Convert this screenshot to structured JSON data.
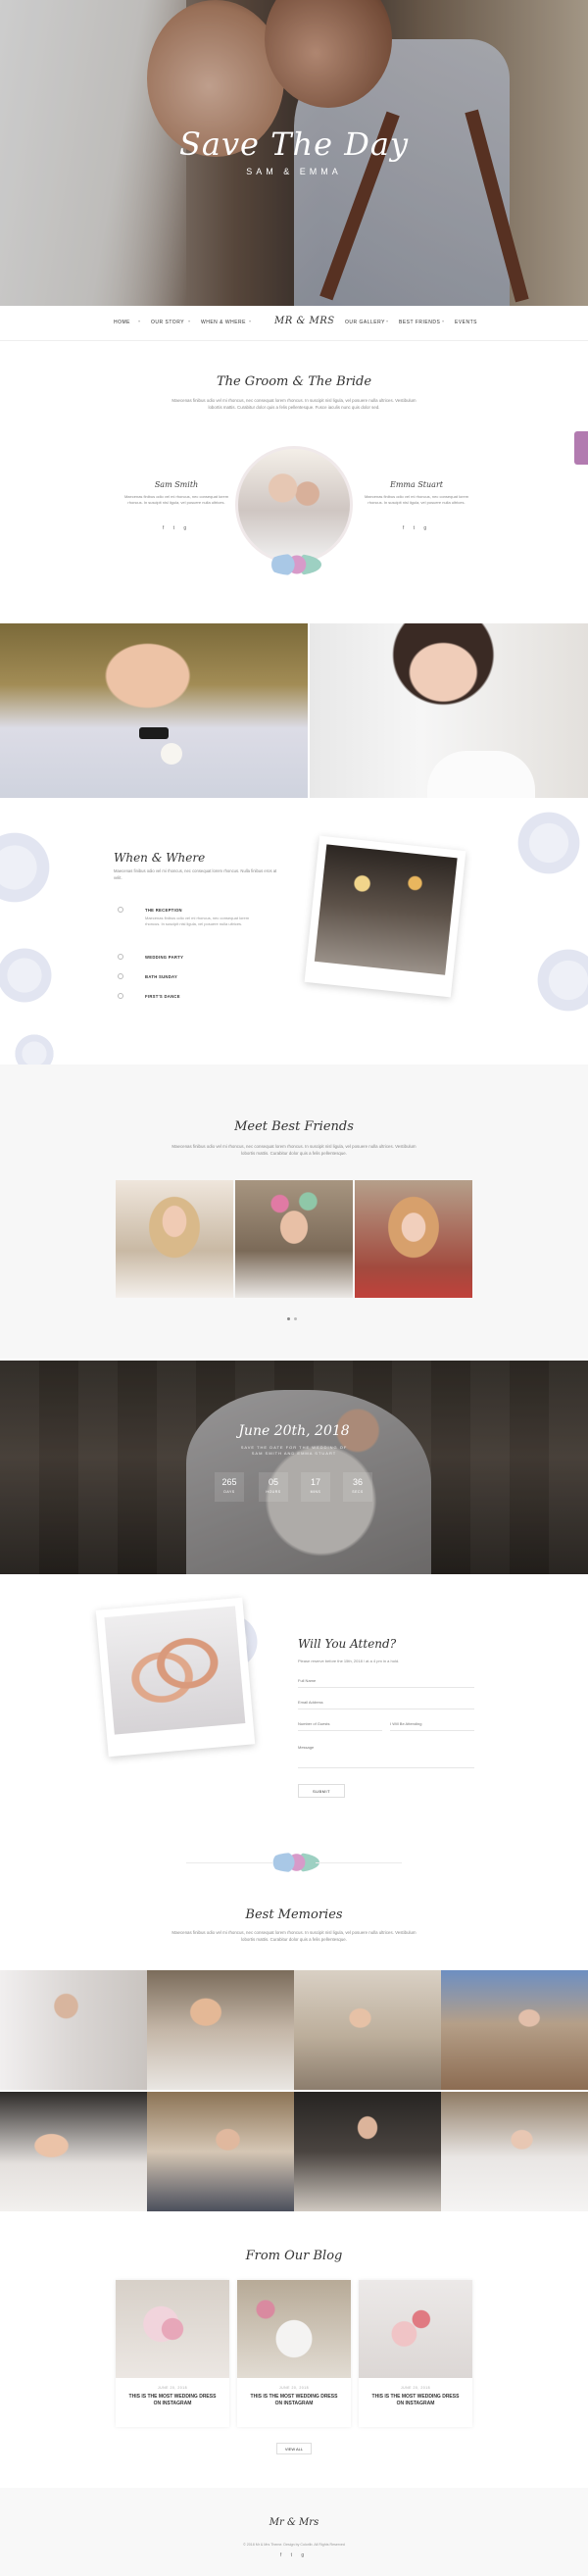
{
  "hero": {
    "title": "Save The Day",
    "subtitle": "SAM & EMMA"
  },
  "nav": {
    "items": [
      "HOME",
      "OUR STORY",
      "WHEN & WHERE",
      "OUR GALLERY",
      "BEST FRIENDS",
      "EVENTS"
    ],
    "logo": "Mr & Mrs"
  },
  "couple": {
    "title": "The Groom & The Bride",
    "desc": "Maecenas finibus odio vel mi rhoncus, nec consequat lorem rhoncus. In suscipit nisl ligula, vel posuere nulla ultrices. Vestibulum lobortis mattis. Curabitur dolor quis a felis pellentesque. Fusce iaculis nunc quis dolor sed.",
    "groom": {
      "name": "Sam Smith",
      "text": "Maecenas finibus odio vel mi rhoncus, nec consequat lorem rhoncus. In suscipit nisl ligula, vel posuere nulla ultrices."
    },
    "bride": {
      "name": "Emma Stuart",
      "text": "Maecenas finibus odio vel mi rhoncus, nec consequat lorem rhoncus. In suscipit nisl ligula, vel posuere nulla ultrices."
    },
    "socials": "f  t  g",
    "side_tag": ""
  },
  "when_where": {
    "title": "When & Where",
    "desc": "Maecenas finibus odio vel mi rhoncus, nec consequat lorem rhoncus. Nulla finibus eros at velit.",
    "events": [
      {
        "label": "THE RECEPTION",
        "text": "Maecenas finibus odio vel mi rhoncus, nec consequat lorem rhoncus. In suscipit nisl ligula, vel posuere nulla ultrices."
      },
      {
        "label": "WEDDING PARTY",
        "text": ""
      },
      {
        "label": "BATH SUNDAY",
        "text": ""
      },
      {
        "label": "FIRST'S DANCE",
        "text": ""
      }
    ]
  },
  "friends": {
    "title": "Meet Best Friends",
    "desc": "Maecenas finibus odio vel mi rhoncus, nec consequat lorem rhoncus. In suscipit nisl ligula, vel posuere nulla ultrices. Vestibulum lobortis mattis. Curabitur dolor quis a felis pellentesque."
  },
  "countdown": {
    "date": "June 20th, 2018",
    "tag1": "SAVE THE DATE FOR THE WEDDING OF",
    "tag2": "SAM SMITH AND EMMA STUART",
    "units": [
      {
        "value": "265",
        "label": "DAYS"
      },
      {
        "value": "05",
        "label": "HOURS"
      },
      {
        "value": "17",
        "label": "MINS"
      },
      {
        "value": "36",
        "label": "SECS"
      }
    ]
  },
  "rsvp": {
    "title": "Will You Attend?",
    "text": "Please reserve before the 15th, 2018 / at a 4 pm in a hold.",
    "fields": {
      "name": "Full Name",
      "email": "Email Address",
      "guests": "Number of Guests",
      "attend": "I Will Be Attending",
      "message": "Message"
    },
    "submit": "SUBMIT"
  },
  "memories": {
    "title": "Best Memories",
    "desc": "Maecenas finibus odio vel mi rhoncus, nec consequat lorem rhoncus. In suscipit nisl ligula, vel posuere nulla ultrices. Vestibulum lobortis mattis. Curabitur dolor quis a felis pellentesque."
  },
  "blog": {
    "title": "From Our Blog",
    "posts": [
      {
        "date": "JUNE 20, 2018",
        "title": "THIS IS THE MOST WEDDING DRESS ON INSTAGRAM"
      },
      {
        "date": "JUNE 20, 2018",
        "title": "THIS IS THE MOST WEDDING DRESS ON INSTAGRAM"
      },
      {
        "date": "JUNE 20, 2018",
        "title": "THIS IS THE MOST WEDDING DRESS ON INSTAGRAM"
      }
    ],
    "view_all": "VIEW ALL"
  },
  "footer": {
    "logo": "Mr & Mrs",
    "copyright": "© 2018 Mr & Mrs Theme. Design by Colorlib. All Rights Reserved",
    "socials": "f  t  g"
  }
}
